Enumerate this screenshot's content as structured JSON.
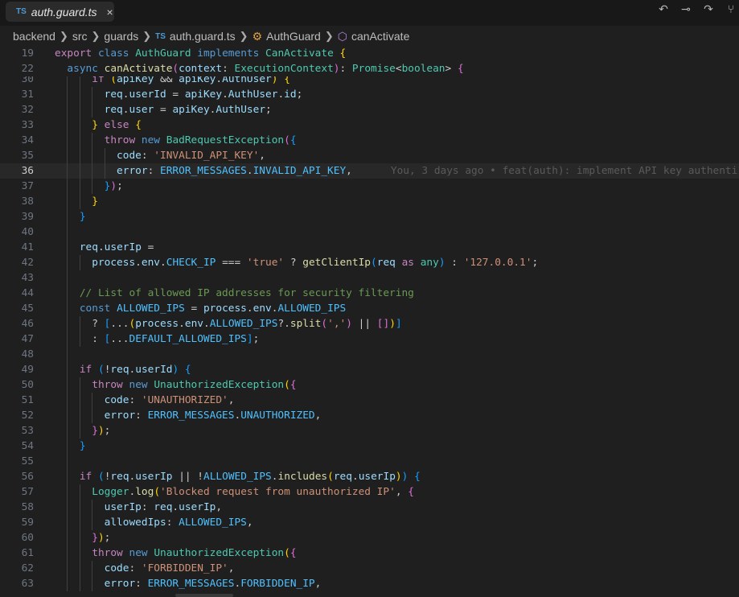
{
  "tab": {
    "lang_badge": "TS",
    "filename": "auth.guard.ts",
    "close_icon": "×"
  },
  "actions": [
    {
      "icon": "go-back-icon",
      "glyph": "↶"
    },
    {
      "icon": "git-commit-icon",
      "glyph": "⊸"
    },
    {
      "icon": "go-forward-icon",
      "glyph": "↷"
    },
    {
      "icon": "git-graph-icon",
      "glyph": "⑂"
    }
  ],
  "breadcrumb": {
    "items": [
      "backend",
      "src",
      "guards"
    ],
    "file_badge": "TS",
    "file": "auth.guard.ts",
    "class": "AuthGuard",
    "method": "canActivate"
  },
  "colors": {
    "editor_bg": "#1f1f1f",
    "keyword": "#569cd6",
    "control": "#c586c0",
    "type": "#4ec9b0",
    "function": "#dcdcaa",
    "variable": "#9cdcfe",
    "string": "#ce9178",
    "constant": "#4fc1ff",
    "comment": "#6a9955"
  },
  "sticky": [
    {
      "n": "19",
      "t": [
        [
          "kw2",
          "export"
        ],
        [
          "p",
          " "
        ],
        [
          "kw",
          "class"
        ],
        [
          "p",
          " "
        ],
        [
          "type",
          "AuthGuard"
        ],
        [
          "p",
          " "
        ],
        [
          "kw",
          "implements"
        ],
        [
          "p",
          " "
        ],
        [
          "type",
          "CanActivate"
        ],
        [
          "p",
          " "
        ],
        [
          "b1",
          "{"
        ]
      ]
    },
    {
      "n": "22",
      "t": [
        [
          "p",
          "  "
        ],
        [
          "kw",
          "async"
        ],
        [
          "p",
          " "
        ],
        [
          "fn",
          "canActivate"
        ],
        [
          "b2",
          "("
        ],
        [
          "var",
          "context"
        ],
        [
          "p",
          ": "
        ],
        [
          "type",
          "ExecutionContext"
        ],
        [
          "b2",
          ")"
        ],
        [
          "p",
          ": "
        ],
        [
          "type",
          "Promise"
        ],
        [
          "p",
          "<"
        ],
        [
          "type",
          "boolean"
        ],
        [
          "p",
          "> "
        ],
        [
          "b2",
          "{"
        ]
      ]
    }
  ],
  "current_line": "36",
  "blame": "You, 3 days ago • feat(auth): implement API key authenti",
  "lines": [
    {
      "n": "30",
      "t": [
        [
          "p",
          "      "
        ],
        [
          "kw2",
          "if"
        ],
        [
          "p",
          " "
        ],
        [
          "b1",
          "("
        ],
        [
          "var",
          "apiKey"
        ],
        [
          "p",
          " && "
        ],
        [
          "var",
          "apiKey"
        ],
        [
          "p",
          "."
        ],
        [
          "var",
          "AuthUser"
        ],
        [
          "b1",
          ")"
        ],
        [
          "p",
          " "
        ],
        [
          "b1",
          "{"
        ]
      ]
    },
    {
      "n": "31",
      "t": [
        [
          "p",
          "        "
        ],
        [
          "var",
          "req"
        ],
        [
          "p",
          "."
        ],
        [
          "var",
          "userId"
        ],
        [
          "p",
          " = "
        ],
        [
          "var",
          "apiKey"
        ],
        [
          "p",
          "."
        ],
        [
          "var",
          "AuthUser"
        ],
        [
          "p",
          "."
        ],
        [
          "var",
          "id"
        ],
        [
          "p",
          ";"
        ]
      ]
    },
    {
      "n": "32",
      "t": [
        [
          "p",
          "        "
        ],
        [
          "var",
          "req"
        ],
        [
          "p",
          "."
        ],
        [
          "var",
          "user"
        ],
        [
          "p",
          " = "
        ],
        [
          "var",
          "apiKey"
        ],
        [
          "p",
          "."
        ],
        [
          "var",
          "AuthUser"
        ],
        [
          "p",
          ";"
        ]
      ]
    },
    {
      "n": "33",
      "t": [
        [
          "p",
          "      "
        ],
        [
          "b1",
          "}"
        ],
        [
          "p",
          " "
        ],
        [
          "kw2",
          "else"
        ],
        [
          "p",
          " "
        ],
        [
          "b1",
          "{"
        ]
      ]
    },
    {
      "n": "34",
      "t": [
        [
          "p",
          "        "
        ],
        [
          "kw2",
          "throw"
        ],
        [
          "p",
          " "
        ],
        [
          "kw",
          "new"
        ],
        [
          "p",
          " "
        ],
        [
          "type",
          "BadRequestException"
        ],
        [
          "b2",
          "("
        ],
        [
          "b3",
          "{"
        ]
      ]
    },
    {
      "n": "35",
      "t": [
        [
          "p",
          "          "
        ],
        [
          "var",
          "code"
        ],
        [
          "p",
          ": "
        ],
        [
          "str",
          "'INVALID_API_KEY'"
        ],
        [
          "p",
          ","
        ]
      ]
    },
    {
      "n": "36",
      "t": [
        [
          "p",
          "          "
        ],
        [
          "var",
          "error"
        ],
        [
          "p",
          ": "
        ],
        [
          "const",
          "ERROR_MESSAGES"
        ],
        [
          "p",
          "."
        ],
        [
          "const",
          "INVALID_API_KEY"
        ],
        [
          "p",
          ","
        ]
      ]
    },
    {
      "n": "37",
      "t": [
        [
          "p",
          "        "
        ],
        [
          "b3",
          "}"
        ],
        [
          "b2",
          ")"
        ],
        [
          "p",
          ";"
        ]
      ]
    },
    {
      "n": "38",
      "t": [
        [
          "p",
          "      "
        ],
        [
          "b1",
          "}"
        ]
      ]
    },
    {
      "n": "39",
      "t": [
        [
          "p",
          "    "
        ],
        [
          "b3",
          "}"
        ]
      ]
    },
    {
      "n": "40",
      "t": []
    },
    {
      "n": "41",
      "t": [
        [
          "p",
          "    "
        ],
        [
          "var",
          "req"
        ],
        [
          "p",
          "."
        ],
        [
          "var",
          "userIp"
        ],
        [
          "p",
          " ="
        ]
      ]
    },
    {
      "n": "42",
      "t": [
        [
          "p",
          "      "
        ],
        [
          "var",
          "process"
        ],
        [
          "p",
          "."
        ],
        [
          "var",
          "env"
        ],
        [
          "p",
          "."
        ],
        [
          "const",
          "CHECK_IP"
        ],
        [
          "p",
          " === "
        ],
        [
          "str",
          "'true'"
        ],
        [
          "p",
          " ? "
        ],
        [
          "fn",
          "getClientIp"
        ],
        [
          "b3",
          "("
        ],
        [
          "var",
          "req"
        ],
        [
          "p",
          " "
        ],
        [
          "kw2",
          "as"
        ],
        [
          "p",
          " "
        ],
        [
          "type",
          "any"
        ],
        [
          "b3",
          ")"
        ],
        [
          "p",
          " : "
        ],
        [
          "str",
          "'127.0.0.1'"
        ],
        [
          "p",
          ";"
        ]
      ]
    },
    {
      "n": "43",
      "t": []
    },
    {
      "n": "44",
      "t": [
        [
          "p",
          "    "
        ],
        [
          "cm",
          "// List of allowed IP addresses for security filtering"
        ]
      ]
    },
    {
      "n": "45",
      "t": [
        [
          "p",
          "    "
        ],
        [
          "kw",
          "const"
        ],
        [
          "p",
          " "
        ],
        [
          "const",
          "ALLOWED_IPS"
        ],
        [
          "p",
          " = "
        ],
        [
          "var",
          "process"
        ],
        [
          "p",
          "."
        ],
        [
          "var",
          "env"
        ],
        [
          "p",
          "."
        ],
        [
          "const",
          "ALLOWED_IPS"
        ]
      ]
    },
    {
      "n": "46",
      "t": [
        [
          "p",
          "      ? "
        ],
        [
          "b3",
          "["
        ],
        [
          "p",
          "..."
        ],
        [
          "b1",
          "("
        ],
        [
          "var",
          "process"
        ],
        [
          "p",
          "."
        ],
        [
          "var",
          "env"
        ],
        [
          "p",
          "."
        ],
        [
          "const",
          "ALLOWED_IPS"
        ],
        [
          "p",
          "?."
        ],
        [
          "fn",
          "split"
        ],
        [
          "b2",
          "("
        ],
        [
          "str",
          "','"
        ],
        [
          "b2",
          ")"
        ],
        [
          "p",
          " || "
        ],
        [
          "b2",
          "[]"
        ],
        [
          "b1",
          ")"
        ],
        [
          "b3",
          "]"
        ]
      ]
    },
    {
      "n": "47",
      "t": [
        [
          "p",
          "      : "
        ],
        [
          "b3",
          "["
        ],
        [
          "p",
          "..."
        ],
        [
          "const",
          "DEFAULT_ALLOWED_IPS"
        ],
        [
          "b3",
          "]"
        ],
        [
          "p",
          ";"
        ]
      ]
    },
    {
      "n": "48",
      "t": []
    },
    {
      "n": "49",
      "t": [
        [
          "p",
          "    "
        ],
        [
          "kw2",
          "if"
        ],
        [
          "p",
          " "
        ],
        [
          "b3",
          "("
        ],
        [
          "p",
          "!"
        ],
        [
          "var",
          "req"
        ],
        [
          "p",
          "."
        ],
        [
          "var",
          "userId"
        ],
        [
          "b3",
          ")"
        ],
        [
          "p",
          " "
        ],
        [
          "b3",
          "{"
        ]
      ]
    },
    {
      "n": "50",
      "t": [
        [
          "p",
          "      "
        ],
        [
          "kw2",
          "throw"
        ],
        [
          "p",
          " "
        ],
        [
          "kw",
          "new"
        ],
        [
          "p",
          " "
        ],
        [
          "type",
          "UnauthorizedException"
        ],
        [
          "b1",
          "("
        ],
        [
          "b2",
          "{"
        ]
      ]
    },
    {
      "n": "51",
      "t": [
        [
          "p",
          "        "
        ],
        [
          "var",
          "code"
        ],
        [
          "p",
          ": "
        ],
        [
          "str",
          "'UNAUTHORIZED'"
        ],
        [
          "p",
          ","
        ]
      ]
    },
    {
      "n": "52",
      "t": [
        [
          "p",
          "        "
        ],
        [
          "var",
          "error"
        ],
        [
          "p",
          ": "
        ],
        [
          "const",
          "ERROR_MESSAGES"
        ],
        [
          "p",
          "."
        ],
        [
          "const",
          "UNAUTHORIZED"
        ],
        [
          "p",
          ","
        ]
      ]
    },
    {
      "n": "53",
      "t": [
        [
          "p",
          "      "
        ],
        [
          "b2",
          "}"
        ],
        [
          "b1",
          ")"
        ],
        [
          "p",
          ";"
        ]
      ]
    },
    {
      "n": "54",
      "t": [
        [
          "p",
          "    "
        ],
        [
          "b3",
          "}"
        ]
      ]
    },
    {
      "n": "55",
      "t": []
    },
    {
      "n": "56",
      "t": [
        [
          "p",
          "    "
        ],
        [
          "kw2",
          "if"
        ],
        [
          "p",
          " "
        ],
        [
          "b3",
          "("
        ],
        [
          "p",
          "!"
        ],
        [
          "var",
          "req"
        ],
        [
          "p",
          "."
        ],
        [
          "var",
          "userIp"
        ],
        [
          "p",
          " || !"
        ],
        [
          "const",
          "ALLOWED_IPS"
        ],
        [
          "p",
          "."
        ],
        [
          "fn",
          "includes"
        ],
        [
          "b1",
          "("
        ],
        [
          "var",
          "req"
        ],
        [
          "p",
          "."
        ],
        [
          "var",
          "userIp"
        ],
        [
          "b1",
          ")"
        ],
        [
          "b3",
          ")"
        ],
        [
          "p",
          " "
        ],
        [
          "b3",
          "{"
        ]
      ]
    },
    {
      "n": "57",
      "t": [
        [
          "p",
          "      "
        ],
        [
          "type",
          "Logger"
        ],
        [
          "p",
          "."
        ],
        [
          "fn",
          "log"
        ],
        [
          "b1",
          "("
        ],
        [
          "str",
          "'Blocked request from unauthorized IP'"
        ],
        [
          "p",
          ", "
        ],
        [
          "b2",
          "{"
        ]
      ]
    },
    {
      "n": "58",
      "t": [
        [
          "p",
          "        "
        ],
        [
          "var",
          "userIp"
        ],
        [
          "p",
          ": "
        ],
        [
          "var",
          "req"
        ],
        [
          "p",
          "."
        ],
        [
          "var",
          "userIp"
        ],
        [
          "p",
          ","
        ]
      ]
    },
    {
      "n": "59",
      "t": [
        [
          "p",
          "        "
        ],
        [
          "var",
          "allowedIps"
        ],
        [
          "p",
          ": "
        ],
        [
          "const",
          "ALLOWED_IPS"
        ],
        [
          "p",
          ","
        ]
      ]
    },
    {
      "n": "60",
      "t": [
        [
          "p",
          "      "
        ],
        [
          "b2",
          "}"
        ],
        [
          "b1",
          ")"
        ],
        [
          "p",
          ";"
        ]
      ]
    },
    {
      "n": "61",
      "t": [
        [
          "p",
          "      "
        ],
        [
          "kw2",
          "throw"
        ],
        [
          "p",
          " "
        ],
        [
          "kw",
          "new"
        ],
        [
          "p",
          " "
        ],
        [
          "type",
          "UnauthorizedException"
        ],
        [
          "b1",
          "("
        ],
        [
          "b2",
          "{"
        ]
      ]
    },
    {
      "n": "62",
      "t": [
        [
          "p",
          "        "
        ],
        [
          "var",
          "code"
        ],
        [
          "p",
          ": "
        ],
        [
          "str",
          "'FORBIDDEN_IP'"
        ],
        [
          "p",
          ","
        ]
      ]
    },
    {
      "n": "63",
      "t": [
        [
          "p",
          "        "
        ],
        [
          "var",
          "error"
        ],
        [
          "p",
          ": "
        ],
        [
          "const",
          "ERROR_MESSAGES"
        ],
        [
          "p",
          "."
        ],
        [
          "const",
          "FORBIDDEN_IP"
        ],
        [
          "p",
          ","
        ]
      ]
    }
  ]
}
